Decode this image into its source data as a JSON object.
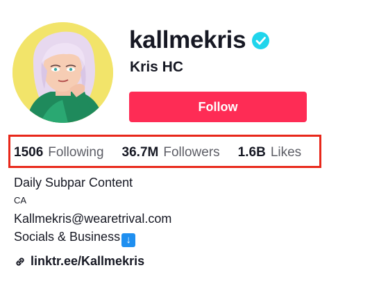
{
  "profile": {
    "username": "kallmekris",
    "display_name": "Kris HC",
    "verified_icon": "verified-check-icon",
    "follow_label": "Follow"
  },
  "stats": {
    "following_value": "1506",
    "following_label": "Following",
    "followers_value": "36.7M",
    "followers_label": "Followers",
    "likes_value": "1.6B",
    "likes_label": "Likes",
    "highlight_color": "#e8271a"
  },
  "bio": {
    "line1": "Daily Subpar Content",
    "line2": "CA",
    "line3": "Kallmekris@wearetrival.com",
    "line4": "Socials & Business",
    "line4_emoji": "↓"
  },
  "link": {
    "icon": "link-icon",
    "text": "linktr.ee/Kallmekris"
  },
  "colors": {
    "follow_button": "#fe2c55",
    "verified": "#20d5ec",
    "avatar_bg": "#f2e46a"
  }
}
